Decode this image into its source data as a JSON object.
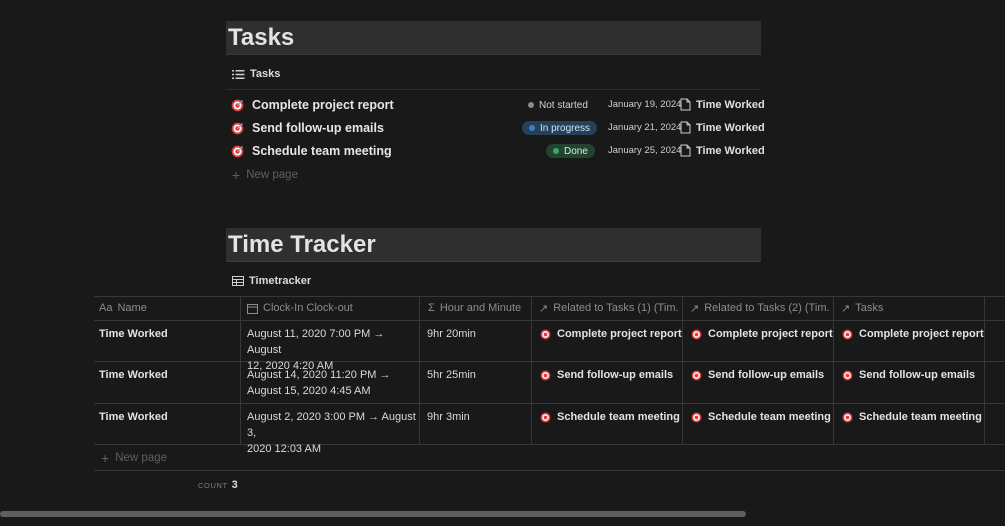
{
  "tasks_section": {
    "title": "Tasks",
    "view_label": "Tasks",
    "rows": [
      {
        "name": "Complete project report",
        "status": "Not started",
        "date": "January 19, 2024",
        "link": "Time Worked"
      },
      {
        "name": "Send follow-up emails",
        "status": "In progress",
        "date": "January 21, 2024",
        "link": "Time Worked"
      },
      {
        "name": "Schedule team meeting",
        "status": "Done",
        "date": "January 25, 2024",
        "link": "Time Worked"
      }
    ],
    "new_page": "New page"
  },
  "time_tracker": {
    "title": "Time Tracker",
    "view_label": "Timetracker",
    "columns": [
      {
        "label": "Name",
        "icon": "Aa"
      },
      {
        "label": "Clock-In Clock-out",
        "icon": "calendar-icon"
      },
      {
        "label": "Hour and Minute",
        "icon": "Σ"
      },
      {
        "label": "Related to Tasks (1) (Tim...",
        "icon": "↗"
      },
      {
        "label": "Related to Tasks (2) (Tim...",
        "icon": "↗"
      },
      {
        "label": "Tasks",
        "icon": "↗"
      }
    ],
    "rows": [
      {
        "name": "Time Worked",
        "clock_line1": "August 11, 2020 7:00 PM → August",
        "clock_line2": "12, 2020 4:20 AM",
        "duration": "9hr 20min",
        "rel1": "Complete project report",
        "rel2": "Complete project report",
        "tasks": "Complete project report"
      },
      {
        "name": "Time Worked",
        "clock_line1": "August 14, 2020 11:20 PM →",
        "clock_line2": "August 15, 2020 4:45 AM",
        "duration": "5hr 25min",
        "rel1": "Send follow-up emails",
        "rel2": "Send follow-up emails",
        "tasks": "Send follow-up emails"
      },
      {
        "name": "Time Worked",
        "clock_line1": "August 2, 2020 3:00 PM → August 3,",
        "clock_line2": "2020 12:03 AM",
        "duration": "9hr 3min",
        "rel1": "Schedule team meeting",
        "rel2": "Schedule team meeting",
        "tasks": "Schedule team meeting"
      }
    ],
    "new_page": "New page",
    "count_label": "COUNT",
    "count_value": "3"
  },
  "colors": {
    "background": "#191919",
    "header_band": "#2f2f2f",
    "in_progress": "#27405a",
    "done": "#22442f",
    "target_icon": "#e03e3e"
  }
}
